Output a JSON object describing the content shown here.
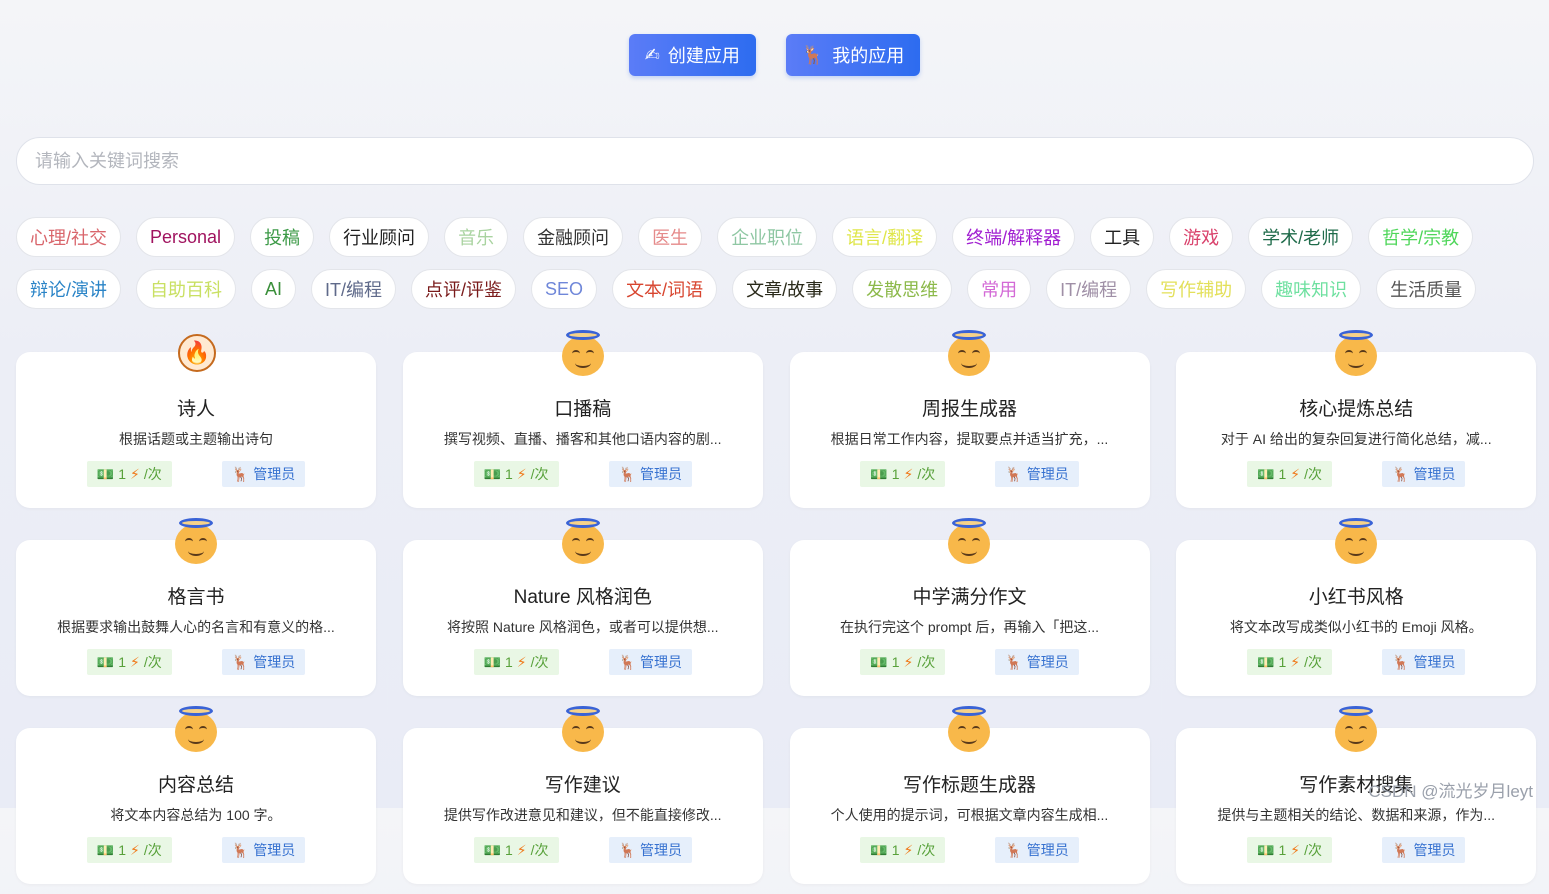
{
  "actions": {
    "create": "创建应用",
    "mine": "我的应用"
  },
  "search": {
    "placeholder": "请输入关键词搜索"
  },
  "tag_rows": [
    [
      {
        "label": "心理/社交",
        "color": "#d9666c"
      },
      {
        "label": "Personal",
        "color": "#a0135f"
      },
      {
        "label": "投稿",
        "color": "#3c9a47"
      },
      {
        "label": "行业顾问",
        "color": "#222222"
      },
      {
        "label": "音乐",
        "color": "#a9d3a0"
      },
      {
        "label": "金融顾问",
        "color": "#333333"
      },
      {
        "label": "医生",
        "color": "#e58a8a"
      },
      {
        "label": "企业职位",
        "color": "#8fc7a3"
      },
      {
        "label": "语言/翻译",
        "color": "#dfe64a"
      },
      {
        "label": "终端/解释器",
        "color": "#a11fd1"
      },
      {
        "label": "工具",
        "color": "#222222"
      },
      {
        "label": "游戏",
        "color": "#d9416b"
      },
      {
        "label": "学术/老师",
        "color": "#1f6b4a"
      },
      {
        "label": "哲学/宗教",
        "color": "#4fd65a"
      }
    ],
    [
      {
        "label": "辩论/演讲",
        "color": "#2a84c7"
      },
      {
        "label": "自助百科",
        "color": "#c9e063"
      },
      {
        "label": "AI",
        "color": "#3a8f3a"
      },
      {
        "label": "IT/编程",
        "color": "#5f6a8a"
      },
      {
        "label": "点评/评鉴",
        "color": "#7a1b1b"
      },
      {
        "label": "SEO",
        "color": "#6f87d9"
      },
      {
        "label": "文本/词语",
        "color": "#d8452f"
      },
      {
        "label": "文章/故事",
        "color": "#2a2a1a"
      },
      {
        "label": "发散思维",
        "color": "#8cb94a"
      },
      {
        "label": "常用",
        "color": "#d36ad6"
      },
      {
        "label": "IT/编程",
        "color": "#9f8fa6"
      },
      {
        "label": "写作辅助",
        "color": "#e3e05a"
      },
      {
        "label": "趣味知识",
        "color": "#6fe0a0"
      },
      {
        "label": "生活质量",
        "color": "#555555"
      }
    ]
  ],
  "card_rows": [
    [
      {
        "avatar": "fire",
        "title": "诗人",
        "desc": "根据话题或主题输出诗句",
        "price": "1",
        "unit": "/次",
        "owner": "管理员"
      },
      {
        "avatar": "angel",
        "title": "口播稿",
        "desc": "撰写视频、直播、播客和其他口语内容的剧...",
        "price": "1",
        "unit": "/次",
        "owner": "管理员"
      },
      {
        "avatar": "angel",
        "title": "周报生成器",
        "desc": "根据日常工作内容，提取要点并适当扩充，...",
        "price": "1",
        "unit": "/次",
        "owner": "管理员"
      },
      {
        "avatar": "angel",
        "title": "核心提炼总结",
        "desc": "对于 AI 给出的复杂回复进行简化总结，减...",
        "price": "1",
        "unit": "/次",
        "owner": "管理员"
      }
    ],
    [
      {
        "avatar": "angel",
        "title": "格言书",
        "desc": "根据要求输出鼓舞人心的名言和有意义的格...",
        "price": "1",
        "unit": "/次",
        "owner": "管理员"
      },
      {
        "avatar": "angel",
        "title": "Nature 风格润色",
        "desc": "将按照 Nature 风格润色，或者可以提供想...",
        "price": "1",
        "unit": "/次",
        "owner": "管理员"
      },
      {
        "avatar": "angel",
        "title": "中学满分作文",
        "desc": "在执行完这个 prompt 后，再输入「把这...",
        "price": "1",
        "unit": "/次",
        "owner": "管理员"
      },
      {
        "avatar": "angel",
        "title": "小红书风格",
        "desc": "将文本改写成类似小红书的 Emoji 风格。",
        "price": "1",
        "unit": "/次",
        "owner": "管理员"
      }
    ],
    [
      {
        "avatar": "angel",
        "title": "内容总结",
        "desc": "将文本内容总结为 100 字。",
        "price": "1",
        "unit": "/次",
        "owner": "管理员"
      },
      {
        "avatar": "angel",
        "title": "写作建议",
        "desc": "提供写作改进意见和建议，但不能直接修改...",
        "price": "1",
        "unit": "/次",
        "owner": "管理员"
      },
      {
        "avatar": "angel",
        "title": "写作标题生成器",
        "desc": "个人使用的提示词，可根据文章内容生成相...",
        "price": "1",
        "unit": "/次",
        "owner": "管理员"
      },
      {
        "avatar": "angel",
        "title": "写作素材搜集",
        "desc": "提供与主题相关的结论、数据和来源，作为...",
        "price": "1",
        "unit": "/次",
        "owner": "管理员"
      }
    ]
  ],
  "watermark": "CSDN @流光岁月leyt"
}
